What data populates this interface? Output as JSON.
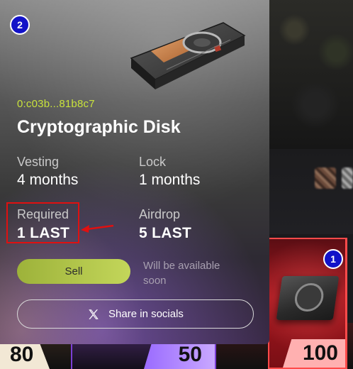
{
  "detail": {
    "badge_number": "2",
    "address": "0:c03b...81b8c7",
    "title": "Cryptographic Disk",
    "stats": {
      "vesting_label": "Vesting",
      "vesting_value": "4 months",
      "lock_label": "Lock",
      "lock_value": "1 months",
      "required_label": "Required",
      "required_value": "1 LAST",
      "airdrop_label": "Airdrop",
      "airdrop_value": "5 LAST"
    },
    "sell_label": "Sell",
    "availability_text": "Will be available soon",
    "share_label": "Share in socials",
    "share_icon": "x-icon"
  },
  "background": {
    "right_card_badge": "1",
    "bottom_values": [
      "80",
      "50",
      "100"
    ]
  },
  "colors": {
    "address": "#c8e23c",
    "sell_button": "#b6c84a",
    "badge": "#1212c8",
    "highlight": "#e01010",
    "right_card_border": "#ff4a4a"
  }
}
